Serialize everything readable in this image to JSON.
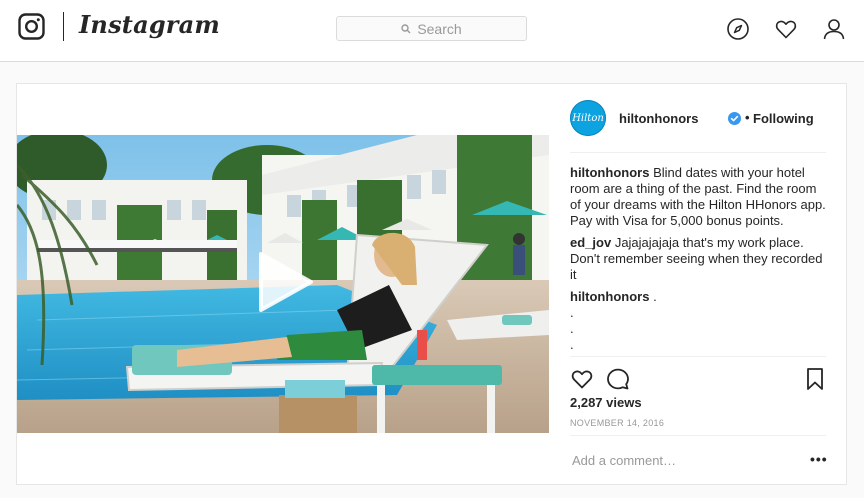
{
  "nav": {
    "wordmark": "Instagram",
    "search_placeholder": "Search",
    "icons": [
      "instagram-glyph-icon",
      "compass-icon",
      "heart-icon",
      "profile-icon"
    ]
  },
  "post": {
    "account": {
      "avatar_text": "Hilton",
      "username": "hiltonhonors",
      "verified": true,
      "separator": "•",
      "follow_status": "Following"
    },
    "media": {
      "type": "video",
      "description_icon": "play-icon"
    },
    "comments": [
      {
        "user": "hiltonhonors",
        "text": "Blind dates with your hotel room are a thing of the past. Find the room of your dreams with the Hilton HHonors app. Pay with Visa for 5,000 bonus points."
      },
      {
        "user": "ed_jov",
        "text": "Jajajajajaja that's my work place. Don't remember seeing when they recorded it"
      },
      {
        "user": "hiltonhonors",
        "text": "."
      }
    ],
    "extra_dots": [
      ".",
      ".",
      "."
    ],
    "views": "2,287 views",
    "date": "NOVEMBER 14, 2016",
    "add_comment_placeholder": "Add a comment…",
    "more_label": "•••"
  },
  "colors": {
    "accent_blue": "#3897f0",
    "avatar_blue": "#0da2e0",
    "border": "#dbdbdb"
  }
}
